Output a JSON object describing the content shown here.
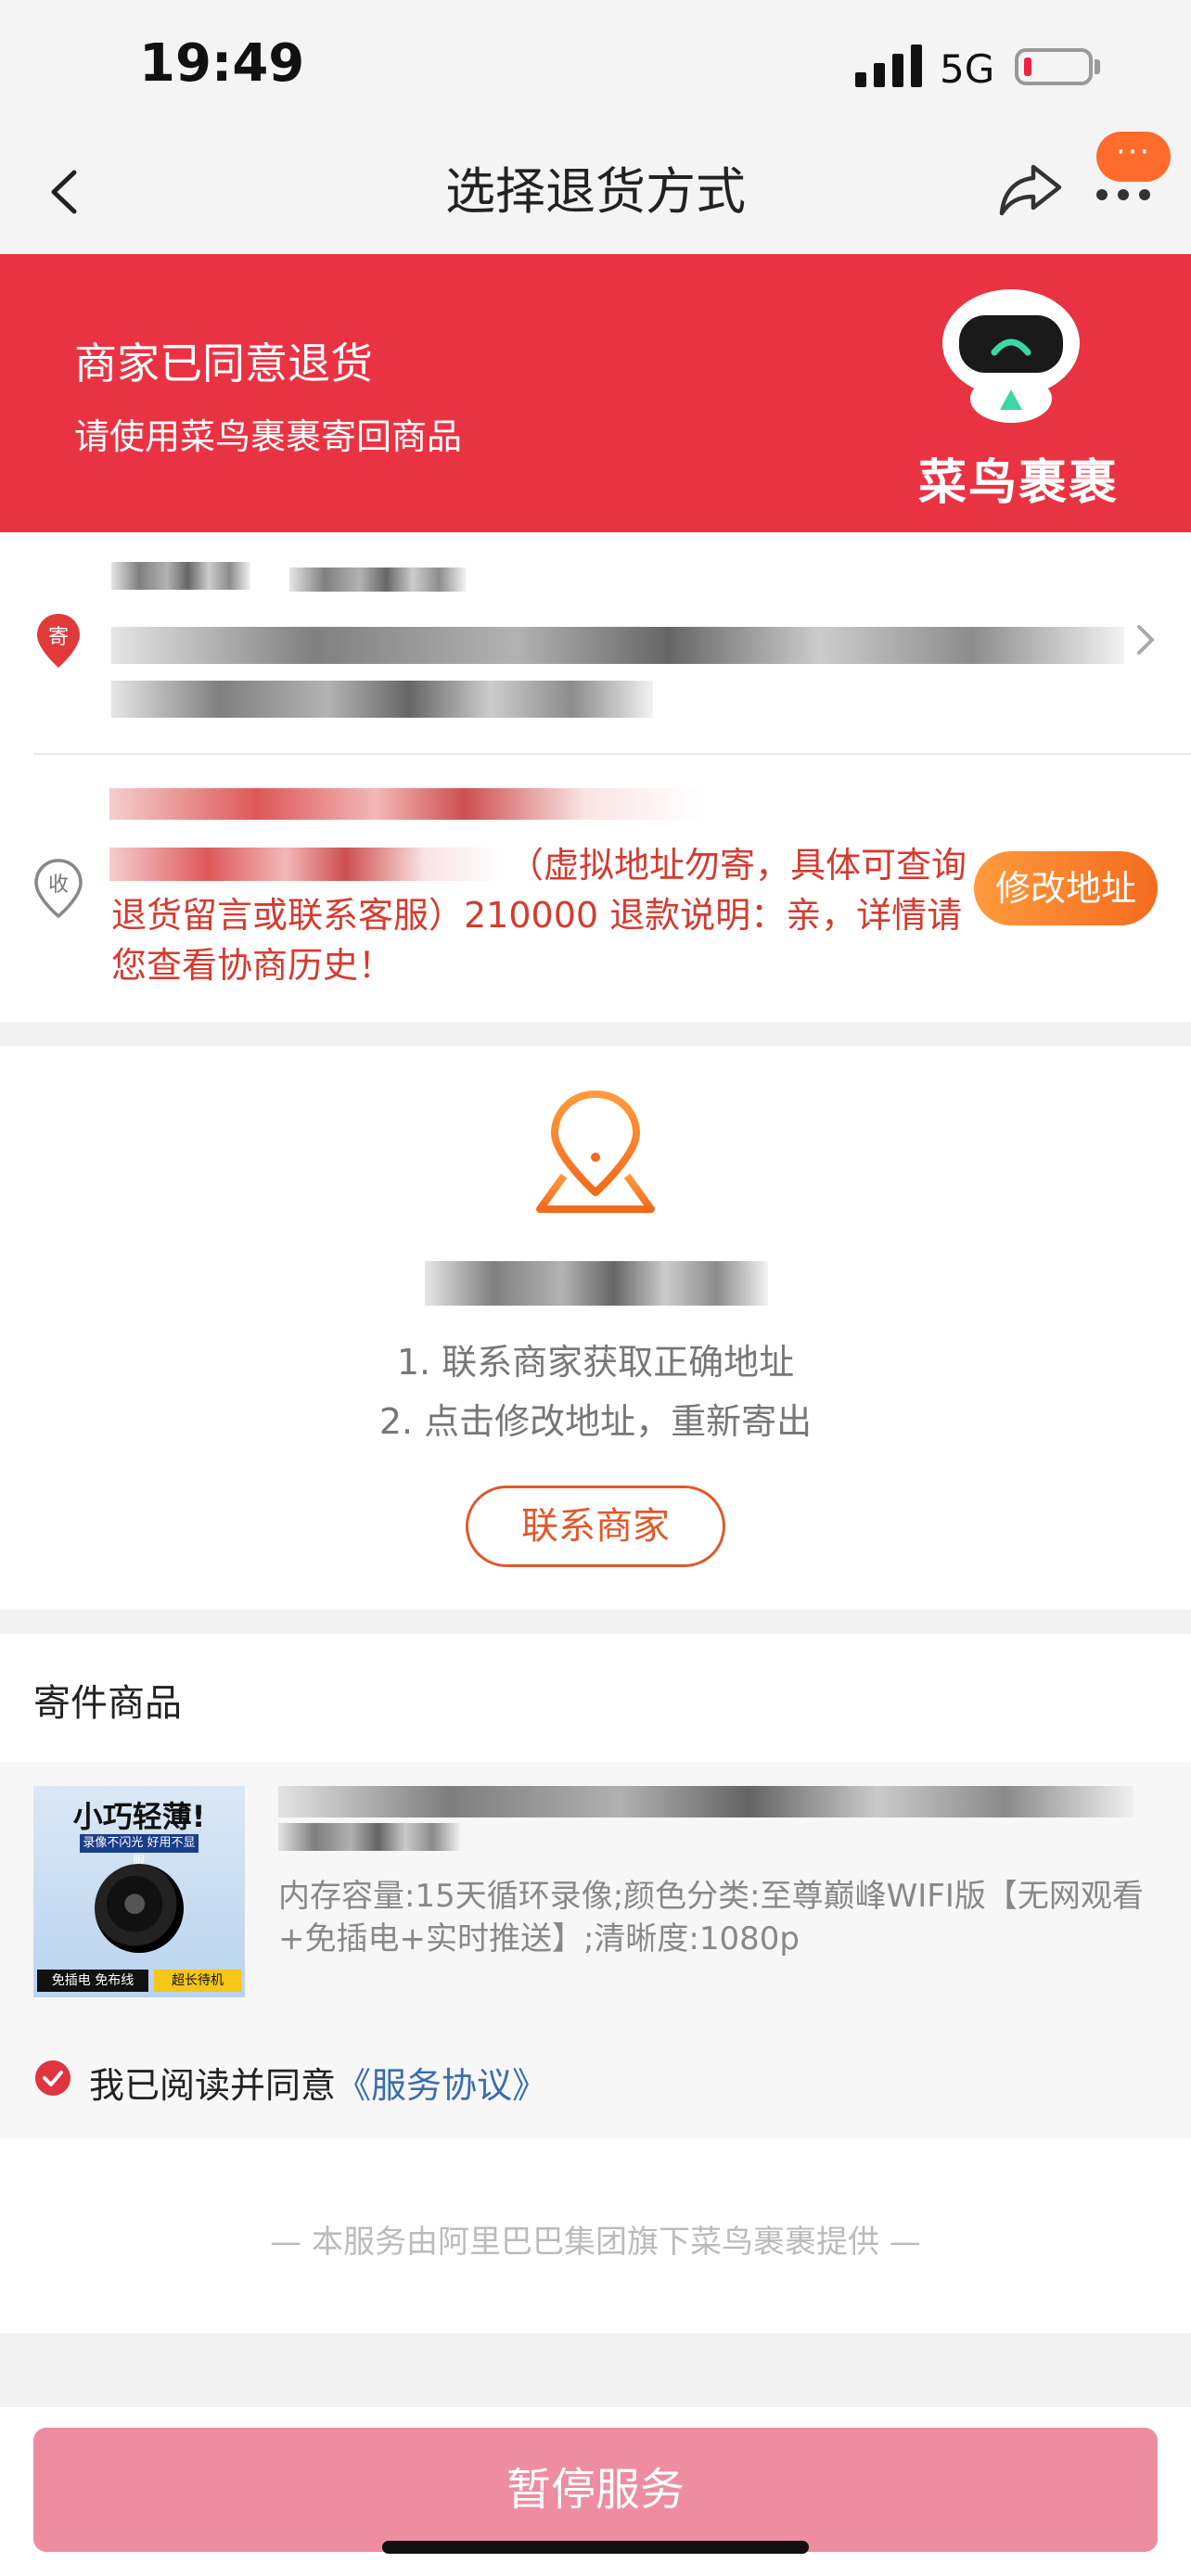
{
  "status_bar": {
    "time": "19:49",
    "network": "5G"
  },
  "nav": {
    "title": "选择退货方式",
    "badge": "···"
  },
  "banner": {
    "heading": "商家已同意退货",
    "subtitle": "请使用菜鸟裹裹寄回商品",
    "brand": "菜鸟裹裹"
  },
  "address": {
    "send_icon_label": "寄",
    "recv_icon_label": "收",
    "recv_note": "（虚拟地址勿寄，具体可查询退货留言或联系客服）210000 退款说明：亲，详情请您查看协商历史！",
    "modify_label": "修改地址"
  },
  "warning": {
    "step1": "1. 联系商家获取正确地址",
    "step2": "2. 点击修改地址，重新寄出",
    "contact_label": "联系商家"
  },
  "goods": {
    "section_title": "寄件商品",
    "thumb_title": "小巧轻薄!",
    "thumb_sub": "录像不闪光  好用不显眼",
    "thumb_left": "免插电 免布线",
    "thumb_right": "超长待机",
    "spec": "内存容量:15天循环录像;颜色分类:至尊巅峰WIFI版【无网观看+免插电+实时推送】;清晰度:1080p"
  },
  "agreement": {
    "text": "我已阅读并同意",
    "link": "《服务协议》"
  },
  "footer": {
    "note": "—    本服务由阿里巴巴集团旗下菜鸟裹裹提供    —"
  },
  "bottom": {
    "pause_label": "暂停服务"
  },
  "colors": {
    "brand_red": "#e93343",
    "orange": "#f46b1f",
    "pause_pink": "#ee8da0",
    "link_blue": "#3a6db0"
  }
}
